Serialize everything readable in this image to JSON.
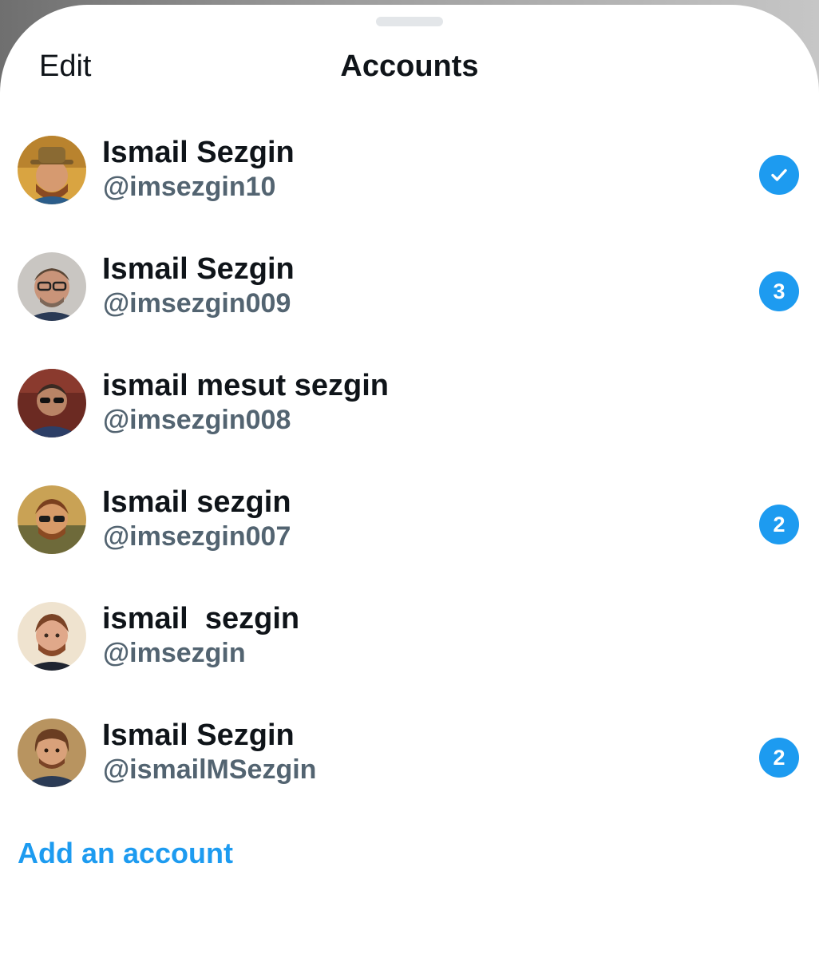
{
  "header": {
    "edit_label": "Edit",
    "title": "Accounts"
  },
  "accounts": [
    {
      "name": "Ismail Sezgin",
      "handle": "@imsezgin10",
      "status": "active",
      "badge": ""
    },
    {
      "name": "Ismail Sezgin",
      "handle": "@imsezgin009",
      "status": "notifications",
      "badge": "3"
    },
    {
      "name": "ismail mesut sezgin",
      "handle": "@imsezgin008",
      "status": "none",
      "badge": ""
    },
    {
      "name": "Ismail sezgin",
      "handle": "@imsezgin007",
      "status": "notifications",
      "badge": "2"
    },
    {
      "name": "ismail  sezgin",
      "handle": "@imsezgin",
      "status": "none",
      "badge": ""
    },
    {
      "name": "Ismail Sezgin",
      "handle": "@ismailMSezgin",
      "status": "notifications",
      "badge": "2"
    }
  ],
  "footer": {
    "add_account_label": "Add an account"
  },
  "icons": {
    "active_account": "checkmark-icon",
    "avatar": "avatar-photo"
  },
  "colors": {
    "accent": "#1d9bf0",
    "text_primary": "#0f1419",
    "text_secondary": "#536471",
    "background": "#ffffff"
  }
}
